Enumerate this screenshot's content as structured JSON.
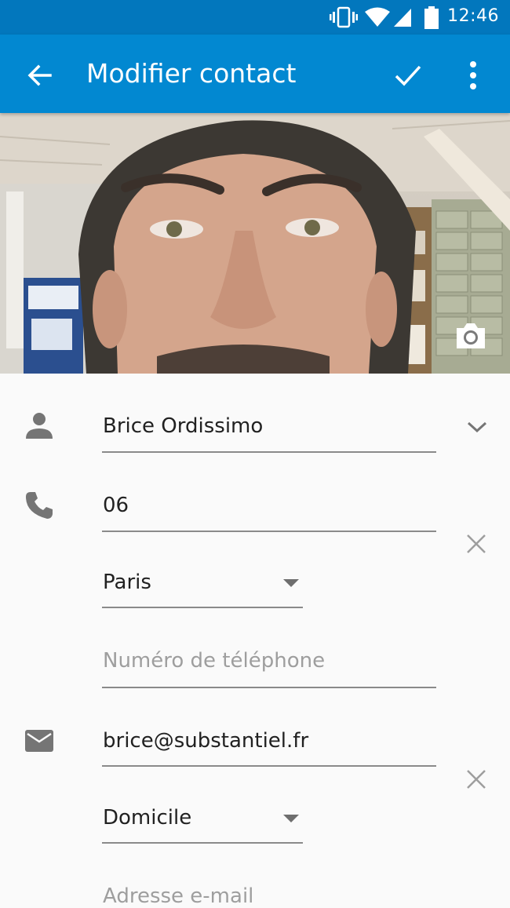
{
  "status_bar": {
    "time": "12:46",
    "icons": [
      "vibrate-icon",
      "wifi-icon",
      "signal-icon",
      "battery-icon"
    ]
  },
  "app_bar": {
    "title": "Modifier contact",
    "background": "#0288d1"
  },
  "photo": {
    "description_icon": "camera-icon"
  },
  "name": {
    "value": "Brice Ordissimo"
  },
  "phone": {
    "value": "06",
    "type": "Paris",
    "new_placeholder": "Numéro de téléphone"
  },
  "email": {
    "value": "brice@substantiel.fr",
    "type": "Domicile",
    "new_placeholder": "Adresse e-mail"
  }
}
